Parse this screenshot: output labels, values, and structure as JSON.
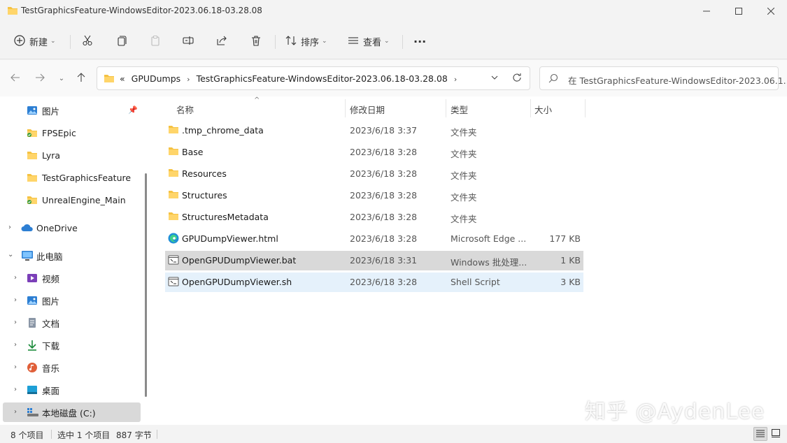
{
  "window": {
    "title": "TestGraphicsFeature-WindowsEditor-2023.06.18-03.28.08"
  },
  "toolbar": {
    "new_label": "新建",
    "sort_label": "排序",
    "view_label": "查看",
    "more_label": "···"
  },
  "address": {
    "prefix": "«",
    "crumbs": [
      "GPUDumps",
      "TestGraphicsFeature-WindowsEditor-2023.06.18-03.28.08"
    ]
  },
  "search": {
    "placeholder": "在 TestGraphicsFeature-WindowsEditor-2023.06.1..."
  },
  "sidebar": {
    "items": [
      {
        "label": "图片",
        "icon": "pictures-icon"
      },
      {
        "label": "FPSEpic",
        "icon": "folder-icon"
      },
      {
        "label": "Lyra",
        "icon": "folder-icon"
      },
      {
        "label": "TestGraphicsFeature",
        "icon": "folder-icon"
      },
      {
        "label": "UnrealEngine_Main",
        "icon": "folder-icon"
      },
      {
        "label": "OneDrive",
        "icon": "cloud-icon"
      },
      {
        "label": "此电脑",
        "icon": "computer-icon"
      },
      {
        "label": "视频",
        "icon": "video-icon"
      },
      {
        "label": "图片",
        "icon": "pictures-icon"
      },
      {
        "label": "文档",
        "icon": "documents-icon"
      },
      {
        "label": "下载",
        "icon": "download-icon"
      },
      {
        "label": "音乐",
        "icon": "music-icon"
      },
      {
        "label": "桌面",
        "icon": "desktop-icon"
      },
      {
        "label": "本地磁盘 (C:)",
        "icon": "drive-icon"
      }
    ]
  },
  "columns": {
    "name": "名称",
    "date": "修改日期",
    "type": "类型",
    "size": "大小"
  },
  "files": [
    {
      "name": ".tmp_chrome_data",
      "date": "2023/6/18 3:37",
      "type": "文件夹",
      "size": "",
      "icon": "folder-icon"
    },
    {
      "name": "Base",
      "date": "2023/6/18 3:28",
      "type": "文件夹",
      "size": "",
      "icon": "folder-icon"
    },
    {
      "name": "Resources",
      "date": "2023/6/18 3:28",
      "type": "文件夹",
      "size": "",
      "icon": "folder-icon"
    },
    {
      "name": "Structures",
      "date": "2023/6/18 3:28",
      "type": "文件夹",
      "size": "",
      "icon": "folder-icon"
    },
    {
      "name": "StructuresMetadata",
      "date": "2023/6/18 3:28",
      "type": "文件夹",
      "size": "",
      "icon": "folder-icon"
    },
    {
      "name": "GPUDumpViewer.html",
      "date": "2023/6/18 3:28",
      "type": "Microsoft Edge ...",
      "size": "177 KB",
      "icon": "edge-icon"
    },
    {
      "name": "OpenGPUDumpViewer.bat",
      "date": "2023/6/18 3:31",
      "type": "Windows 批处理...",
      "size": "1 KB",
      "icon": "script-icon"
    },
    {
      "name": "OpenGPUDumpViewer.sh",
      "date": "2023/6/18 3:28",
      "type": "Shell Script",
      "size": "3 KB",
      "icon": "script-icon"
    }
  ],
  "status": {
    "count": "8 个项目",
    "selected": "选中 1 个项目",
    "bytes": "887 字节"
  },
  "watermark": "知乎 @AydenLee",
  "colors": {
    "folder": "#f5c242",
    "selected_row": "#d9d9d9",
    "hover_row": "#e5f1fb"
  }
}
